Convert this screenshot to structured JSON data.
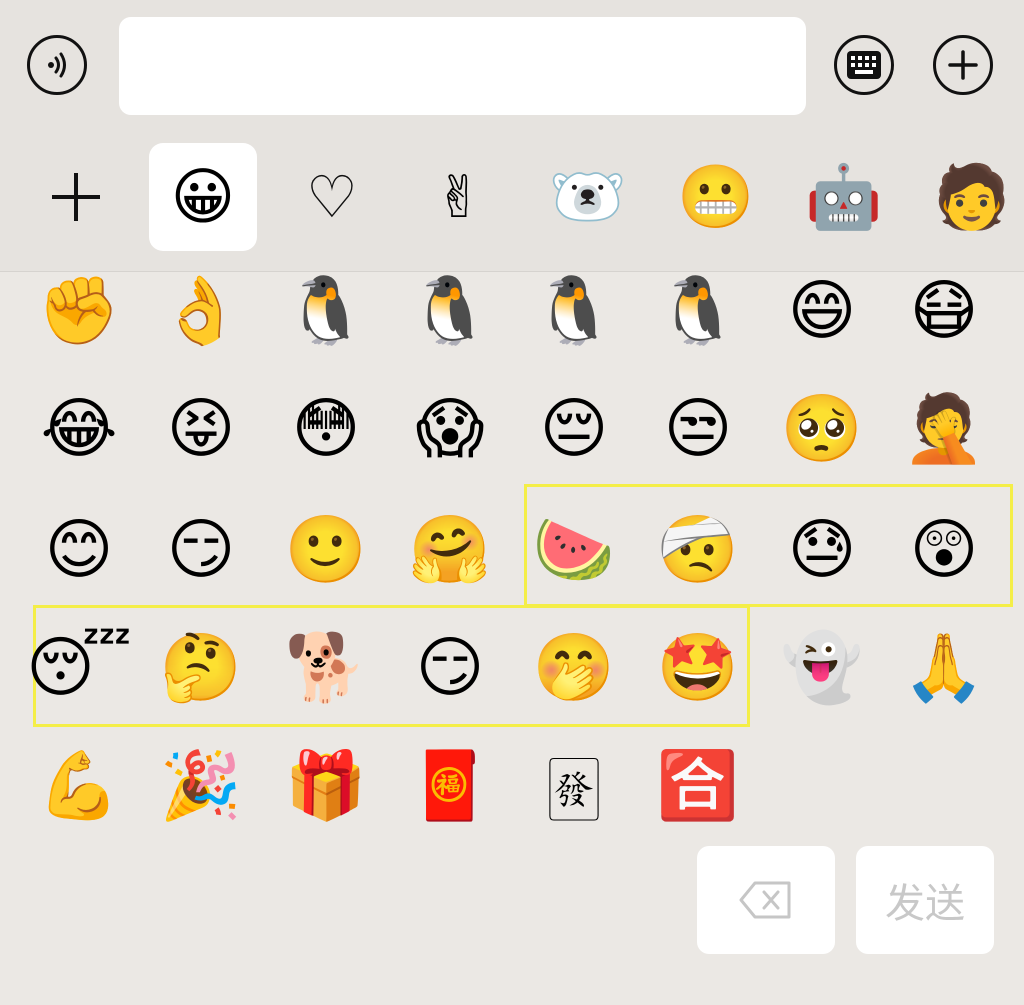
{
  "input": {
    "value": "",
    "placeholder": ""
  },
  "icons": {
    "voice": "voice-wave-icon",
    "keyboard": "keyboard-icon",
    "more": "plus-circle-icon",
    "add_sticker": "plus-icon",
    "delete": "backspace-icon"
  },
  "tabs": [
    {
      "name": "add",
      "glyph": "＋",
      "active": false
    },
    {
      "name": "emoji",
      "glyph": "😀",
      "active": true
    },
    {
      "name": "favorites",
      "glyph": "♡",
      "active": false
    },
    {
      "name": "sticker-victory-hand",
      "glyph": "✌",
      "active": false
    },
    {
      "name": "sticker-bear",
      "glyph": "🐻‍❄️",
      "active": false
    },
    {
      "name": "sticker-grin-face",
      "glyph": "😬",
      "active": false
    },
    {
      "name": "sticker-robot",
      "glyph": "🤖",
      "active": false
    },
    {
      "name": "sticker-person",
      "glyph": "🧑",
      "active": false
    }
  ],
  "emoji_rows": [
    [
      "✊",
      "👌",
      "🐧",
      "🐧",
      "🐧",
      "🐧",
      "😄",
      "😷"
    ],
    [
      "😂",
      "😝",
      "😳",
      "😱",
      "😔",
      "😒",
      "🥺",
      "🤦"
    ],
    [
      "😊",
      "😏",
      "🙂",
      "🤗",
      "🍉",
      "🤕",
      "😓",
      "😲"
    ],
    [
      "😴",
      "🤔",
      "🐕",
      "😏",
      "🤭",
      "🤩",
      "👻",
      "🙏"
    ],
    [
      "💪",
      "🎉",
      "🎁",
      "🧧",
      "🀅",
      "🈴"
    ]
  ],
  "highlight_color": "#f4ee47",
  "send": {
    "label": "发送"
  }
}
